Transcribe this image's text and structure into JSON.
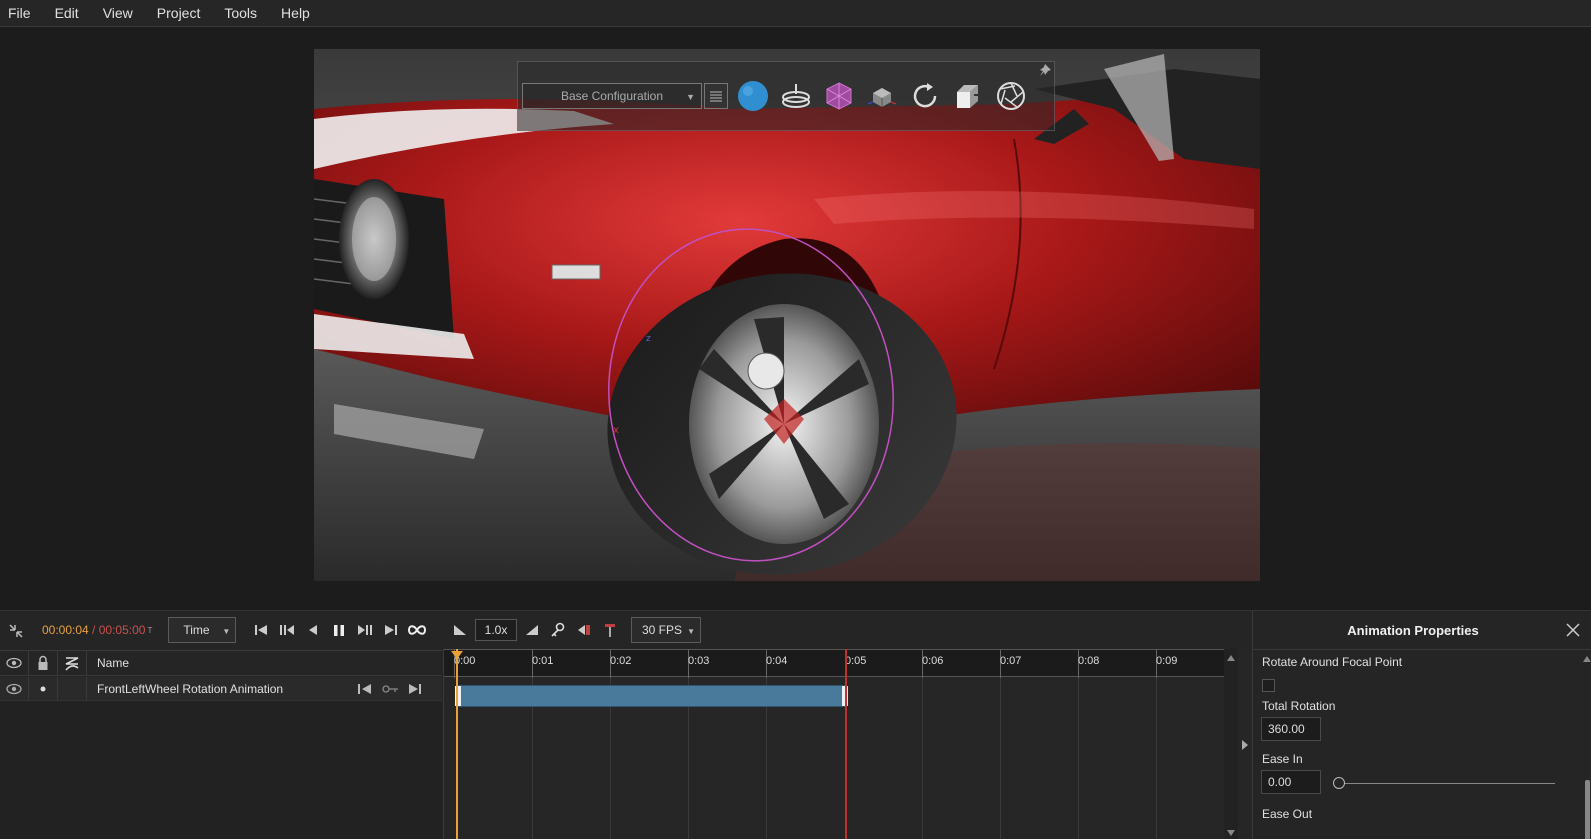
{
  "menu": [
    "File",
    "Edit",
    "View",
    "Project",
    "Tools",
    "Help"
  ],
  "viewport_toolbar": {
    "configuration": "Base Configuration",
    "icons": [
      "configurations-menu-icon",
      "environment-sphere-icon",
      "turntable-icon",
      "material-cube-icon",
      "model-cube-icon",
      "reset-view-icon",
      "scene-box-icon",
      "camera-aperture-icon",
      "pin-icon"
    ]
  },
  "transport": {
    "current_time": "00:00:04",
    "separator": " / ",
    "total_time": "00:05:00",
    "time_unit": "T",
    "mode": "Time",
    "speed": "1.0x",
    "fps": "30 FPS"
  },
  "tracks": {
    "header_name": "Name",
    "rows": [
      {
        "name": "FrontLeftWheel Rotation Animation"
      }
    ]
  },
  "timeline": {
    "ticks": [
      "0:00",
      "0:01",
      "0:02",
      "0:03",
      "0:04",
      "0:05",
      "0:06",
      "0:07",
      "0:08",
      "0:09"
    ],
    "clip_start_s": 0,
    "clip_end_s": 5,
    "playhead_s": 0
  },
  "properties": {
    "title": "Animation Properties",
    "rotate_focal_label": "Rotate Around Focal Point",
    "rotate_focal_checked": false,
    "total_rotation_label": "Total Rotation",
    "total_rotation_value": "360.00",
    "ease_in_label": "Ease In",
    "ease_in_value": "0.00",
    "ease_out_label": "Ease Out"
  },
  "colors": {
    "accent_orange": "#e8a13a",
    "accent_red": "#c03030",
    "clip_blue": "#4a7a9b",
    "car_red": "#b01818"
  }
}
